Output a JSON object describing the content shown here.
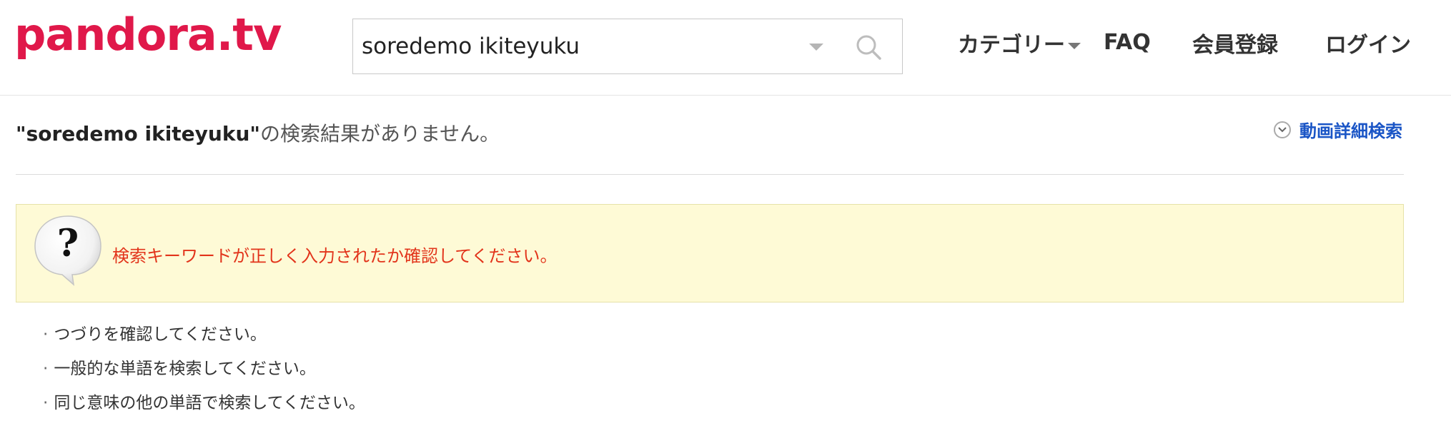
{
  "header": {
    "logo_text": "pandora.tv",
    "search": {
      "value": "soredemo ikiteyuku",
      "placeholder": ""
    },
    "nav": {
      "category_label": "カテゴリー",
      "faq_label": "FAQ",
      "register_label": "会員登録",
      "login_label": "ログイン"
    }
  },
  "result": {
    "keyword": "\"soredemo ikiteyuku\"",
    "message": "の検索結果がありません。",
    "advanced_search_label": "動画詳細検索"
  },
  "notice": {
    "text": "検索キーワードが正しく入力されたか確認してください。"
  },
  "tips": [
    "つづりを確認してください。",
    "一般的な単語を検索してください。",
    "同じ意味の他の単語で検索してください。"
  ],
  "colors": {
    "brand": "#e0184a",
    "link": "#1a55c6",
    "notice_bg": "#fefad6",
    "notice_text": "#e2341b"
  },
  "icons": {
    "search": "search-icon",
    "dropdown": "chevron-down-icon",
    "help": "question-bubble-icon",
    "advanced": "circle-chevron-down-icon"
  }
}
